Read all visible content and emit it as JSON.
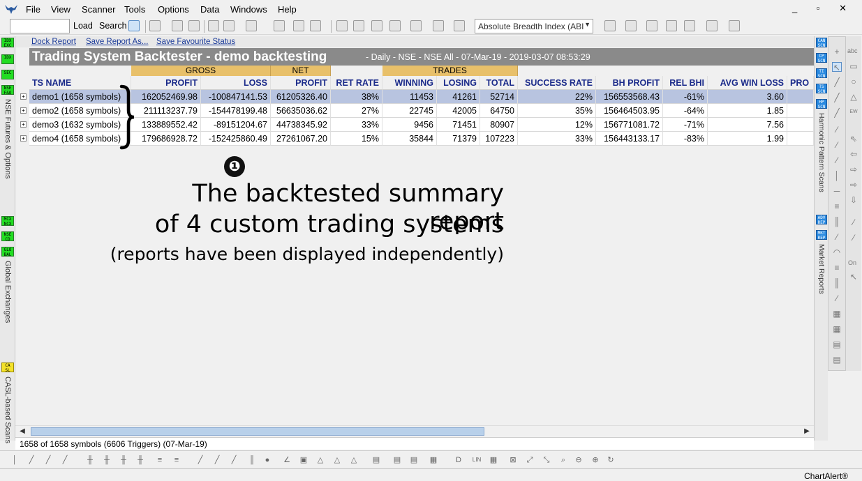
{
  "menu": {
    "items": [
      "File",
      "View",
      "Scanner",
      "Tools",
      "Options",
      "Data",
      "Windows",
      "Help"
    ],
    "window_controls": "_ ▫ ✕"
  },
  "toolbar": {
    "load_label": "Load",
    "search_label": "Search",
    "indicator_select": "Absolute Breadth Index (ABI"
  },
  "left_strip": {
    "tags_top": [
      "IDX EXC",
      "IDX",
      "SEC",
      "NSE F&O"
    ],
    "label_top": "NSE Futures & Options",
    "tags_mid": [
      "MCX NCX",
      "NSE CD",
      "GLO BAL"
    ],
    "label_mid": "Global Exchanges",
    "tags_bot": [
      "CA SL"
    ],
    "label_bot": "CASL-based Scans"
  },
  "right_strip": {
    "tags_top": [
      "CAN SCN",
      "CP SCN",
      "TI SCN",
      "TS SCN",
      "HP SCN"
    ],
    "label_top": "Harmonic Pattern Scans",
    "tags_bot": [
      "ADV REP",
      "MKT REP"
    ],
    "label_bot": "Market Reports"
  },
  "panel": {
    "links": [
      "Dock Report",
      "Save Report As...",
      "Save Favourite Status"
    ],
    "title": "Trading System Backtester - demo backtesting",
    "subtitle": "- Daily - NSE - NSE All - 07-Mar-19 - 2019-03-07 08:53:29"
  },
  "table": {
    "group_headers": [
      "GROSS",
      "NET",
      "TRADES"
    ],
    "columns": [
      "TS NAME",
      "PROFIT",
      "LOSS",
      "PROFIT",
      "RET RATE",
      "WINNING",
      "LOSING",
      "TOTAL",
      "SUCCESS RATE",
      "BH PROFIT",
      "REL BHI",
      "AVG WIN LOSS",
      "PRO"
    ],
    "rows": [
      [
        "demo1 (1658 symbols)",
        "162052469.98",
        "-100847141.53",
        "61205326.40",
        "38%",
        "11453",
        "41261",
        "52714",
        "22%",
        "156553568.43",
        "-61%",
        "3.60",
        ""
      ],
      [
        "demo2 (1658 symbols)",
        "211113237.79",
        "-154478199.48",
        "56635036.62",
        "27%",
        "22745",
        "42005",
        "64750",
        "35%",
        "156464503.95",
        "-64%",
        "1.85",
        ""
      ],
      [
        "demo3 (1632 symbols)",
        "133889552.42",
        "-89151204.67",
        "44738345.92",
        "33%",
        "9456",
        "71451",
        "80907",
        "12%",
        "156771081.72",
        "-71%",
        "7.56",
        ""
      ],
      [
        "demo4 (1658 symbols)",
        "179686928.72",
        "-152425860.49",
        "27261067.20",
        "15%",
        "35844",
        "71379",
        "107223",
        "33%",
        "156443133.17",
        "-83%",
        "1.99",
        ""
      ]
    ]
  },
  "annotation": {
    "number": "❶",
    "line1": "The backtested summary report",
    "line2": "of 4 custom trading systems",
    "line3": "(reports have been displayed independently)"
  },
  "status": {
    "line": "1658 of 1658 symbols (6606 Triggers) (07-Mar-19)",
    "brand": "ChartAlert®"
  },
  "colors": {
    "group_header": "#e8c06a",
    "title_bar": "#8a8a8a",
    "header_text": "#1a2a8a",
    "selected_row": "#b8c4e0",
    "link": "#1a3a9a"
  }
}
